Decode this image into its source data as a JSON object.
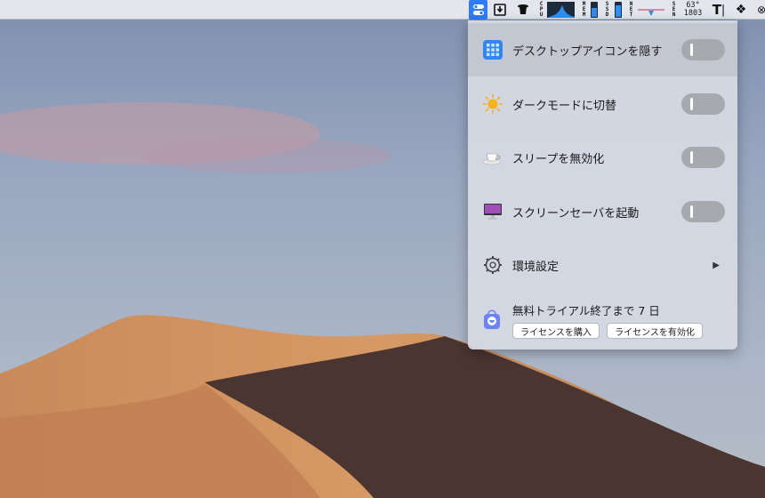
{
  "menubar": {
    "cpu_label": "CPU",
    "mem_label": "MEM",
    "ssd_label": "SSD",
    "net_label": "NET",
    "sen_label": "SEN",
    "sensor_temp": "63°",
    "sensor_fan": "1803",
    "text_icon": "T"
  },
  "menu": {
    "items": [
      {
        "label": "デスクトップアイコンを隠す",
        "icon": "grid-icon",
        "toggle": false
      },
      {
        "label": "ダークモードに切替",
        "icon": "sun-icon",
        "toggle": false
      },
      {
        "label": "スリープを無効化",
        "icon": "coffee-cup-icon",
        "toggle": false
      },
      {
        "label": "スクリーンセーバを起動",
        "icon": "monitor-icon",
        "toggle": false
      },
      {
        "label": "環境設定",
        "icon": "gear-icon",
        "submenu": true
      }
    ],
    "trial": {
      "text": "無料トライアル終了まで 7 日",
      "buy_label": "ライセンスを購入",
      "activate_label": "ライセンスを有効化"
    }
  }
}
